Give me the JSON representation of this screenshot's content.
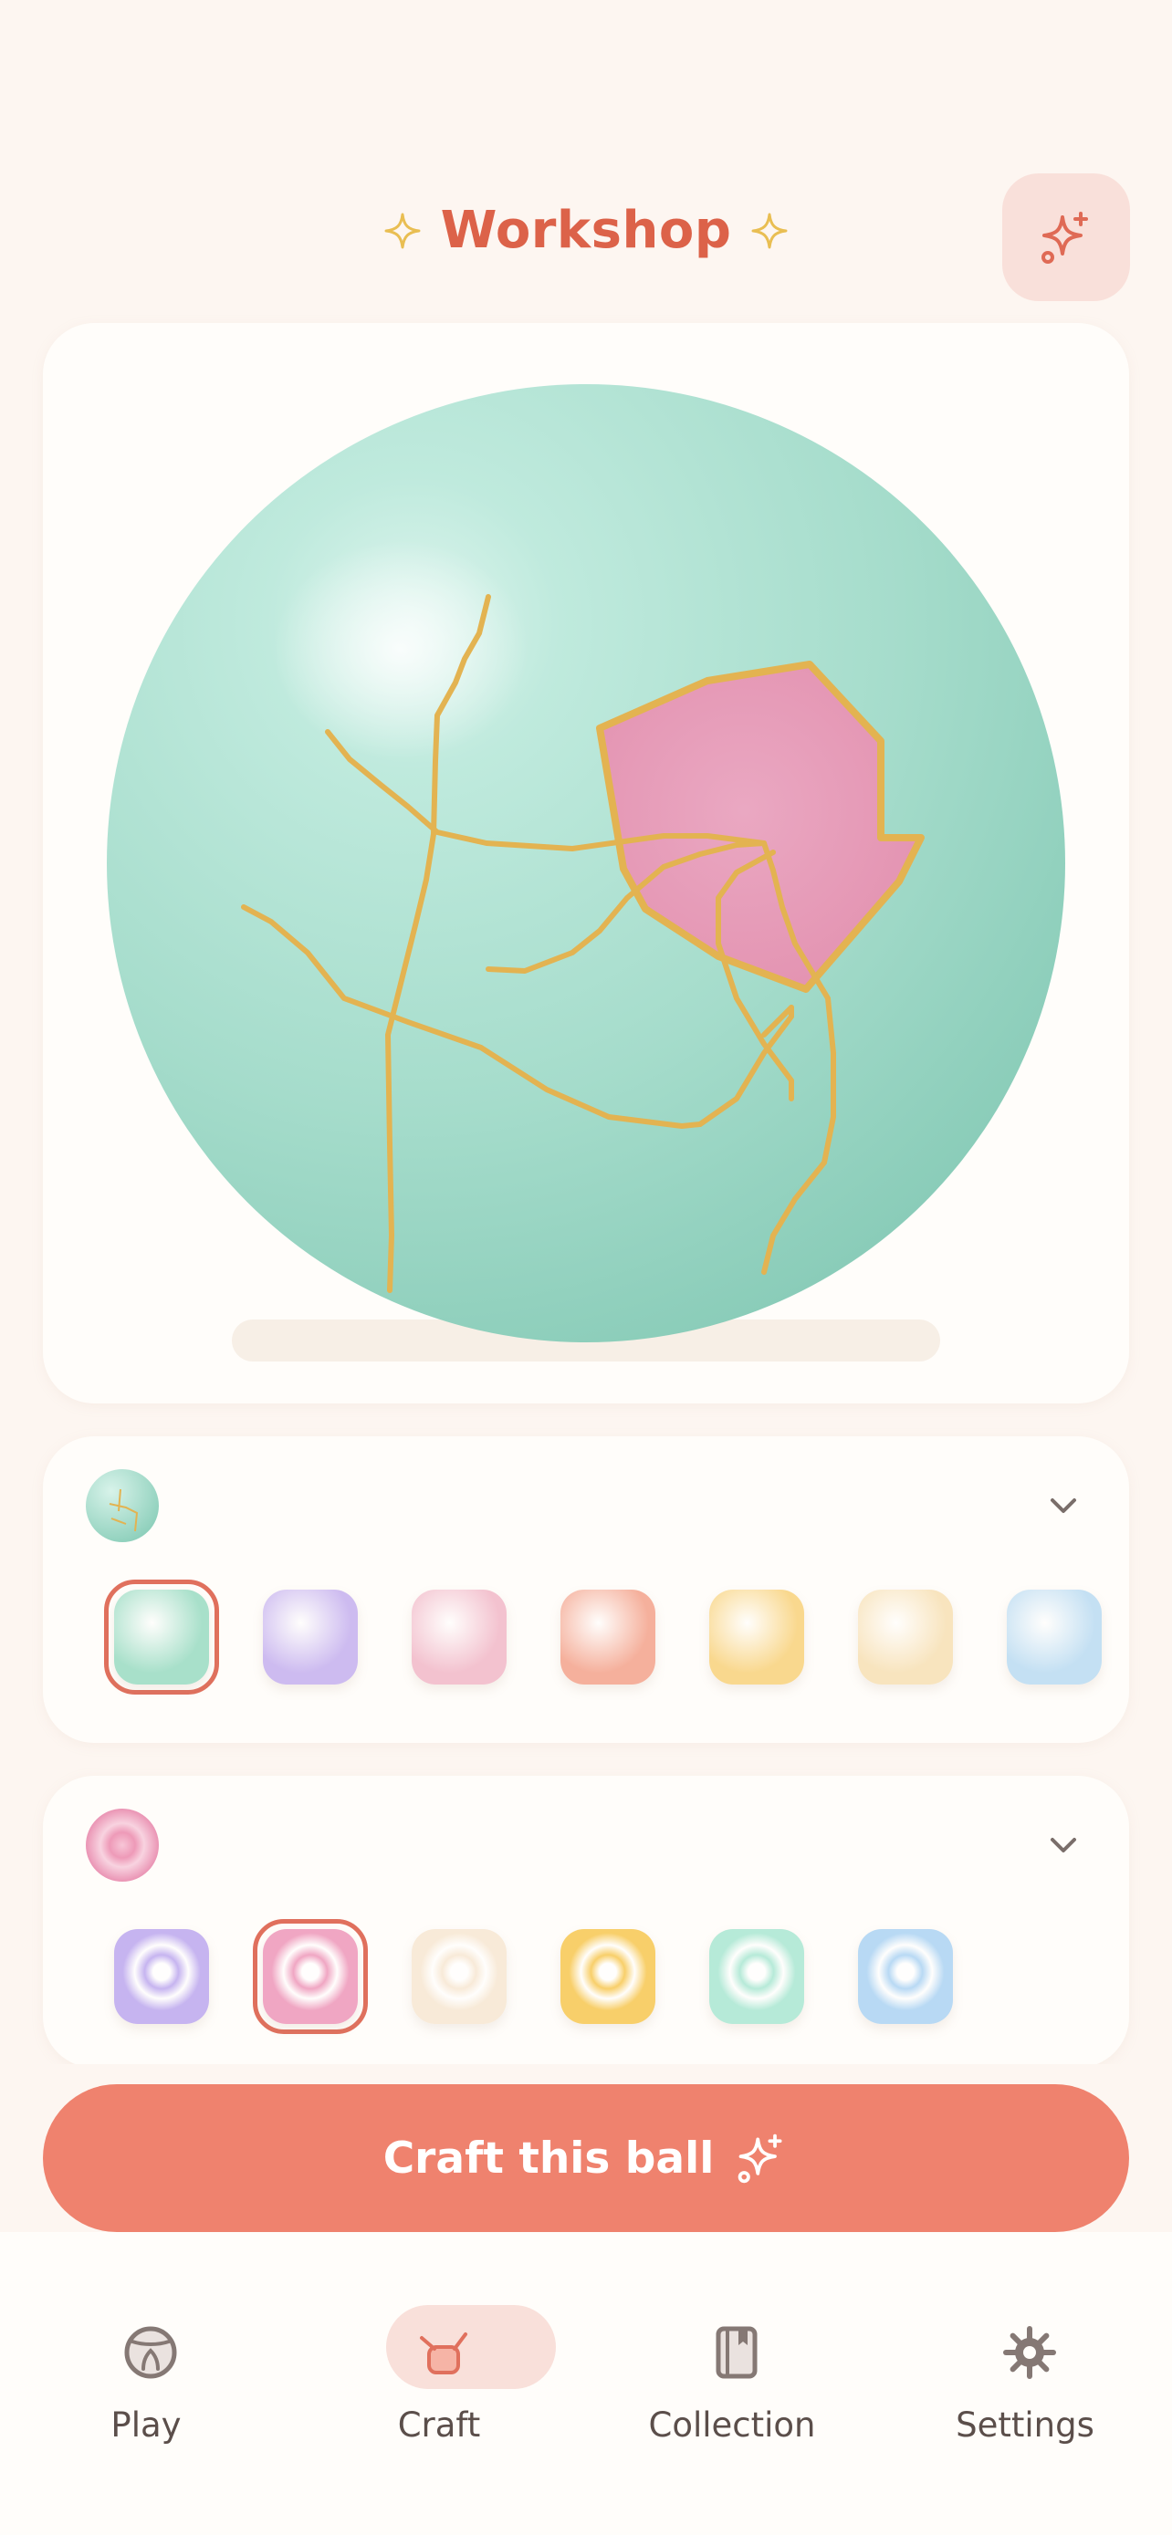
{
  "header": {
    "title": "Workshop",
    "magic_button_icon": "sparkles-icon",
    "title_decoration_icon": "sparkle-icon"
  },
  "preview": {
    "ball_base_color": "#a8dfcd",
    "patch_color": "#e99ab7",
    "crack_color": "#e3b351"
  },
  "base_picker": {
    "icon": "mint-ball-icon",
    "chevron_icon": "chevron-down-icon",
    "selected_index": 0,
    "swatches": [
      "#a8e0ca",
      "#cdbbf0",
      "#f3c2cf",
      "#f5b09c",
      "#f9d88e",
      "#f8e4be",
      "#c4e0f3"
    ]
  },
  "pattern_picker": {
    "icon": "pink-swirl-icon",
    "chevron_icon": "chevron-down-icon",
    "selected_index": 1,
    "swatches": [
      "#c6b4f0",
      "#f0a6c3",
      "#f8ead8",
      "#f8cf6a",
      "#b6ead8",
      "#b8d9f4"
    ]
  },
  "craft_button": {
    "label": "Craft this ball",
    "icon": "sparkles-icon"
  },
  "tabs": [
    {
      "label": "Play",
      "icon": "ball-icon",
      "active": false
    },
    {
      "label": "Craft",
      "icon": "craft-icon",
      "active": true
    },
    {
      "label": "Collection",
      "icon": "book-icon",
      "active": false
    },
    {
      "label": "Settings",
      "icon": "gear-icon",
      "active": false
    }
  ],
  "colors": {
    "accent": "#ef826e",
    "title": "#dc6249",
    "background": "#fdf6f1",
    "card": "#fffdfa",
    "gold": "#e3b351"
  }
}
